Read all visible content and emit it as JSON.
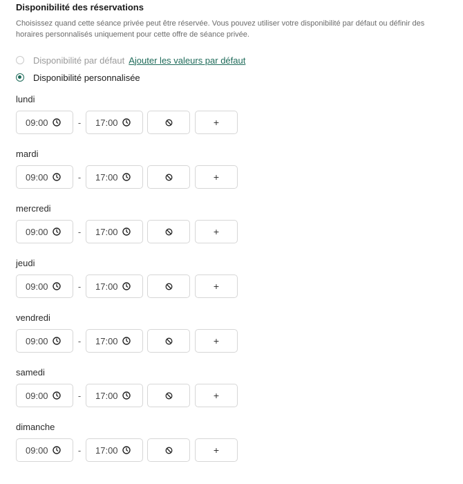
{
  "section": {
    "title": "Disponibilité des réservations",
    "description": "Choisissez quand cette séance privée peut être réservée. Vous pouvez utiliser votre disponibilité par défaut ou définir des horaires personnalisés uniquement pour cette offre de séance privée."
  },
  "options": {
    "default_label": "Disponibilité par défaut",
    "default_link": "Ajouter les valeurs par défaut",
    "custom_label": "Disponibilité personnalisée",
    "selected": "custom"
  },
  "separator": "-",
  "days": [
    {
      "name": "lundi",
      "start": "09:00",
      "end": "17:00"
    },
    {
      "name": "mardi",
      "start": "09:00",
      "end": "17:00"
    },
    {
      "name": "mercredi",
      "start": "09:00",
      "end": "17:00"
    },
    {
      "name": "jeudi",
      "start": "09:00",
      "end": "17:00"
    },
    {
      "name": "vendredi",
      "start": "09:00",
      "end": "17:00"
    },
    {
      "name": "samedi",
      "start": "09:00",
      "end": "17:00"
    },
    {
      "name": "dimanche",
      "start": "09:00",
      "end": "17:00"
    }
  ],
  "buttons": {
    "block_icon": "block-icon",
    "add_glyph": "+"
  },
  "colors": {
    "accent": "#1f6b5a",
    "border": "#d6d6d6",
    "muted_text": "#6b6b6b"
  }
}
